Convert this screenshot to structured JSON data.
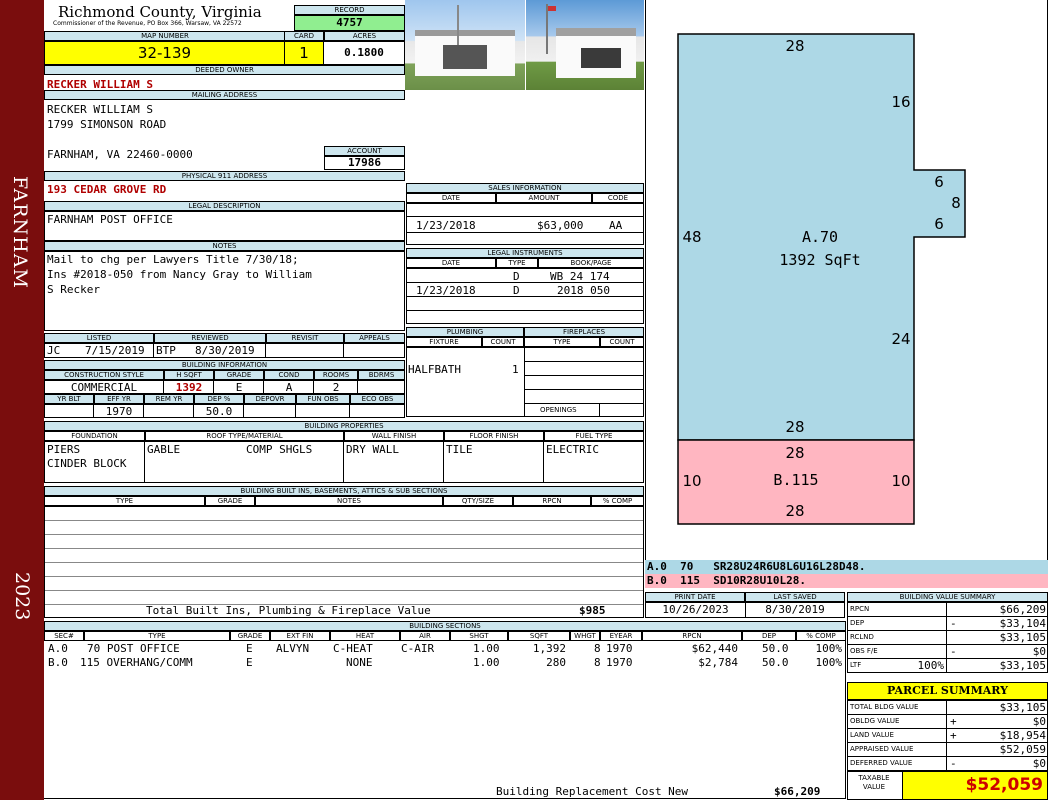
{
  "sidebar": {
    "district": "FARNHAM",
    "year": "2023"
  },
  "header": {
    "county": "Richmond County, Virginia",
    "commissioner": "Commissioner of the Revenue, PO Box 366, Warsaw, VA 22572",
    "record_label": "RECORD",
    "record": "4757",
    "map_label": "MAP NUMBER",
    "map": "32-139",
    "card_label": "CARD",
    "card": "1",
    "acres_label": "ACRES",
    "acres": "0.1800"
  },
  "owner": {
    "deeded_label": "DEEDED OWNER",
    "deeded": "RECKER WILLIAM S",
    "mailing_label": "MAILING ADDRESS",
    "mail_lines": [
      "RECKER WILLIAM S",
      "1799 SIMONSON ROAD",
      "",
      "FARNHAM, VA 22460-0000"
    ],
    "account_label": "ACCOUNT",
    "account": "17986",
    "physical_label": "PHYSICAL 911 ADDRESS",
    "physical": "193 CEDAR GROVE RD",
    "legal_label": "LEGAL DESCRIPTION",
    "legal": "FARNHAM POST OFFICE",
    "notes_label": "NOTES",
    "notes_lines": [
      "Mail to chg per Lawyers Title 7/30/18;",
      "Ins #2018-050 from Nancy Gray to William",
      "S Recker"
    ]
  },
  "review": {
    "listed_label": "LISTED",
    "reviewed_label": "REVIEWED",
    "revisit_label": "REVISIT",
    "appeals_label": "APPEALS",
    "listed_by": "JC",
    "listed_date": "7/15/2019",
    "reviewed_by": "BTP",
    "reviewed_date": "8/30/2019"
  },
  "building_info": {
    "title": "BUILDING INFORMATION",
    "h": [
      "CONSTRUCTION STYLE",
      "H SQFT",
      "GRADE",
      "COND",
      "ROOMS",
      "BDRMS"
    ],
    "style": "COMMERCIAL",
    "hsqft": "1392",
    "grade": "E",
    "cond": "A",
    "rooms": "2",
    "h2": [
      "YR BLT",
      "EFF YR",
      "REM YR",
      "DEP %",
      "DEPOVR",
      "FUN OBS",
      "ECO OBS"
    ],
    "eff_yr": "1970",
    "dep": "50.0"
  },
  "sales": {
    "title": "SALES INFORMATION",
    "h": [
      "DATE",
      "AMOUNT",
      "CODE"
    ],
    "date": "1/23/2018",
    "amount": "$63,000",
    "code": "AA"
  },
  "legal_instruments": {
    "title": "LEGAL INSTRUMENTS",
    "h": [
      "DATE",
      "TYPE",
      "BOOK/PAGE"
    ],
    "rows": [
      {
        "date": "",
        "type": "D",
        "book": "WB 24 174"
      },
      {
        "date": "1/23/2018",
        "type": "D",
        "book": "2018 050"
      }
    ]
  },
  "plumbing": {
    "title": "PLUMBING",
    "h": [
      "FIXTURE",
      "COUNT"
    ],
    "fixture": "HALFBATH",
    "count": "1"
  },
  "fireplaces": {
    "title": "FIREPLACES",
    "h": [
      "TYPE",
      "COUNT"
    ],
    "openings_label": "OPENINGS"
  },
  "properties": {
    "title": "BUILDING PROPERTIES",
    "h": [
      "FOUNDATION",
      "ROOF TYPE/MATERIAL",
      "WALL FINISH",
      "FLOOR FINISH",
      "FUEL TYPE"
    ],
    "foundation": [
      "PIERS",
      "CINDER BLOCK"
    ],
    "roof_type": "GABLE",
    "roof_mat": "COMP SHGLS",
    "wall": "DRY WALL",
    "floor": "TILE",
    "fuel": "ELECTRIC"
  },
  "builtins": {
    "title": "BUILDING BUILT INS, BASEMENTS, ATTICS & SUB SECTIONS",
    "h": [
      "TYPE",
      "GRADE",
      "NOTES",
      "QTY/SIZE",
      "RPCN",
      "% COMP"
    ],
    "total_label": "Total Built Ins, Plumbing & Fireplace Value",
    "total": "$985"
  },
  "sections": {
    "title": "BUILDING SECTIONS",
    "h": [
      "SEC#",
      "TYPE",
      "GRADE",
      "EXT FIN",
      "HEAT",
      "AIR",
      "SHGT",
      "SQFT",
      "WHGT",
      "EYEAR",
      "RPCN",
      "DEP",
      "% COMP"
    ],
    "rows": [
      {
        "sec": "A.0",
        "type": "70 POST OFFICE",
        "grade": "E",
        "ext": "ALVYN",
        "heat": "C-HEAT",
        "air": "C-AIR",
        "shgt": "1.00",
        "sqft": "1,392",
        "whgt": "8",
        "eyear": "1970",
        "rpcn": "$62,440",
        "dep": "50.0",
        "comp": "100%"
      },
      {
        "sec": "B.0",
        "type": "115 OVERHANG/COMM",
        "grade": "E",
        "ext": "",
        "heat": "NONE",
        "air": "",
        "shgt": "1.00",
        "sqft": "280",
        "whgt": "8",
        "eyear": "1970",
        "rpcn": "$2,784",
        "dep": "50.0",
        "comp": "100%"
      }
    ],
    "replacement_label": "Building Replacement Cost New",
    "replacement": "$66,209"
  },
  "sketch": {
    "a_label": "A.70",
    "a_area": "1392 SqFt",
    "b_label": "B.115",
    "dims": {
      "top": "28",
      "right_upper": "16",
      "bump_top": "6",
      "bump_side": "8",
      "bump_bottom": "6",
      "left": "48",
      "right_lower": "24",
      "a_bottom": "28",
      "b_top": "28",
      "b_left": "10",
      "b_right": "10",
      "b_bottom": "28"
    },
    "codes": [
      "A.0  70   SR28U24R6U8L6U16L28D48.",
      "B.0  115  SD10R28U10L28."
    ],
    "colors": {
      "a": "#add8e6",
      "b": "#ffb6c1"
    }
  },
  "dates": {
    "print_label": "PRINT DATE",
    "print": "10/26/2023",
    "saved_label": "LAST SAVED",
    "saved": "8/30/2019"
  },
  "value_summary": {
    "title": "BUILDING VALUE SUMMARY",
    "rows": [
      {
        "label": "RPCN",
        "sign": "",
        "value": "$66,209"
      },
      {
        "label": "DEP",
        "sign": "-",
        "value": "$33,104"
      },
      {
        "label": "RCLND",
        "sign": "",
        "value": "$33,105"
      },
      {
        "label": "OBS F/E",
        "sign": "-",
        "value": "$0"
      },
      {
        "label": "LTF",
        "sign": "100%",
        "value": "$33,105"
      }
    ]
  },
  "parcel": {
    "title": "PARCEL SUMMARY",
    "rows": [
      {
        "label": "TOTAL BLDG VALUE",
        "sign": "",
        "value": "$33,105"
      },
      {
        "label": "OBLDG VALUE",
        "sign": "+",
        "value": "$0"
      },
      {
        "label": "LAND VALUE",
        "sign": "+",
        "value": "$18,954"
      },
      {
        "label": "APPRAISED VALUE",
        "sign": "",
        "value": "$52,059"
      },
      {
        "label": "DEFERRED VALUE",
        "sign": "-",
        "value": "$0"
      }
    ],
    "taxable_label": "TAXABLE VALUE",
    "taxable": "$52,059"
  }
}
